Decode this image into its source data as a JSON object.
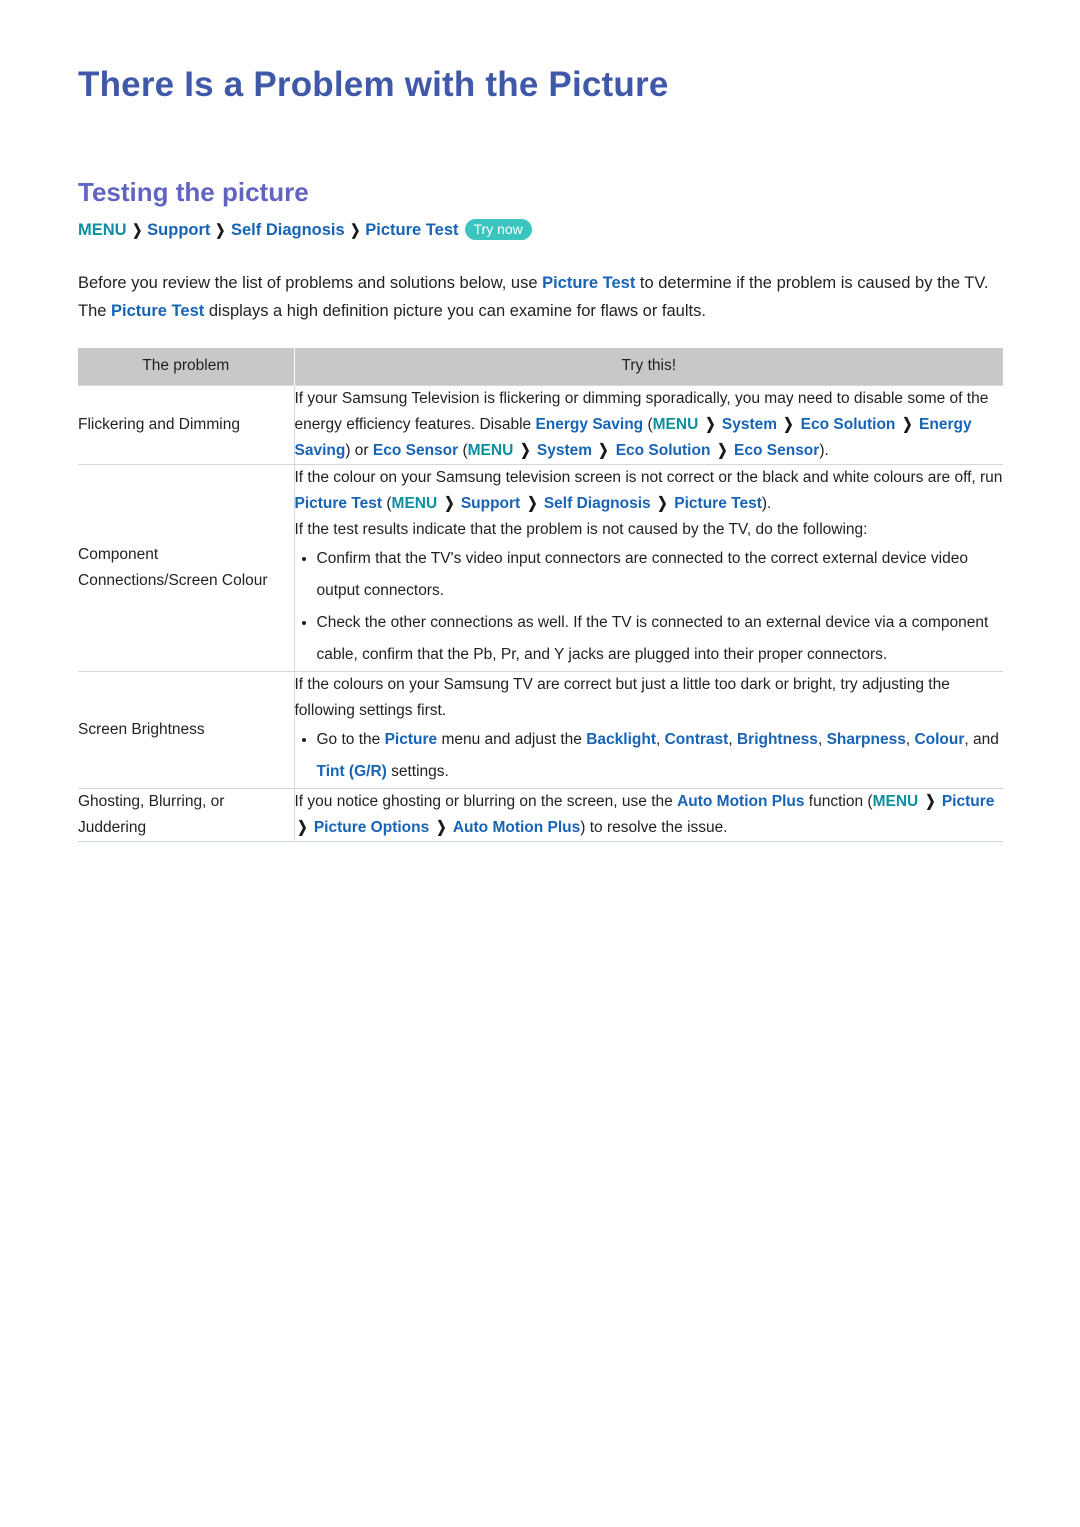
{
  "page": {
    "title": "There Is a Problem with the Picture",
    "section_title": "Testing the picture"
  },
  "colors": {
    "title": "#3f59a8",
    "section_title": "#6164c0",
    "link_blue": "#1763b6",
    "menu_teal": "#0c8f9e",
    "badge_teal": "#3ac6be",
    "table_header_gray": "#c8c8c8"
  },
  "breadcrumb": {
    "menu": "MENU",
    "separator": "❯",
    "items": [
      "Support",
      "Self Diagnosis",
      "Picture Test"
    ],
    "badge": "Try now"
  },
  "intro": {
    "part1": "Before you review the list of problems and solutions below, use ",
    "link1": "Picture Test",
    "part2": " to determine if the problem is caused by the TV. The ",
    "link2": "Picture Test",
    "part3": " displays a high definition picture you can examine for flaws or faults."
  },
  "table": {
    "headers": [
      "The problem",
      "Try this!"
    ],
    "rows": [
      {
        "problem": "Flickering and Dimming",
        "solution": {
          "paragraph_text_1": "If your Samsung Television is flickering or dimming sporadically, you may need to disable some of the energy efficiency features. Disable ",
          "link_energy_saving": "Energy Saving",
          "open_paren": " (",
          "menu": "MENU",
          "sep": "❯",
          "link_system": "System",
          "link_eco_solution": "Eco Solution",
          "link_energy_saving_2": "Energy Saving",
          "close_paren_or": ") or ",
          "link_eco_sensor": "Eco Sensor",
          "open_paren_2": " (",
          "menu_2": "MENU",
          "link_system_2": "System",
          "link_eco_solution_2": "Eco Solution",
          "link_eco_sensor_2": "Eco Sensor",
          "close_paren": ")."
        }
      },
      {
        "problem": "Component Connections/Screen Colour",
        "solution": {
          "p1_a": "If the colour on your Samsung television screen is not correct or the black and white colours are off, run ",
          "p1_link1": "Picture Test",
          "p1_open": " (",
          "p1_menu": "MENU",
          "sep": "❯",
          "p1_support": "Support",
          "p1_selfdiag": "Self Diagnosis",
          "p1_picturetest": "Picture Test",
          "p1_close": ").",
          "p2": "If the test results indicate that the problem is not caused by the TV, do the following:",
          "bullets": [
            "Confirm that the TV's video input connectors are connected to the correct external device video output connectors.",
            "Check the other connections as well. If the TV is connected to an external device via a component cable, confirm that the Pb, Pr, and Y jacks are plugged into their proper connectors."
          ]
        }
      },
      {
        "problem": "Screen Brightness",
        "solution": {
          "p1": "If the colours on your Samsung TV are correct but just a little too dark or bright, try adjusting the following settings first.",
          "bullet_a": "Go to the ",
          "link_picture": "Picture",
          "bullet_b": " menu and adjust the ",
          "link_backlight": "Backlight",
          "comma1": ", ",
          "link_contrast": "Contrast",
          "comma2": ", ",
          "link_brightness": "Brightness",
          "comma3": ", ",
          "link_sharpness": "Sharpness",
          "comma4": ", ",
          "link_colour": "Colour",
          "and": ", and ",
          "link_tint": "Tint (G/R)",
          "bullet_c": " settings."
        }
      },
      {
        "problem": "Ghosting, Blurring, or Juddering",
        "solution": {
          "a": "If you notice ghosting or blurring on the screen, use the ",
          "link_amp": "Auto Motion Plus",
          "b": " function (",
          "menu": "MENU",
          "sep": "❯",
          "link_picture": "Picture",
          "link_picture_options": "Picture Options",
          "link_amp2": "Auto Motion Plus",
          "c": ") to resolve the issue."
        }
      }
    ]
  }
}
